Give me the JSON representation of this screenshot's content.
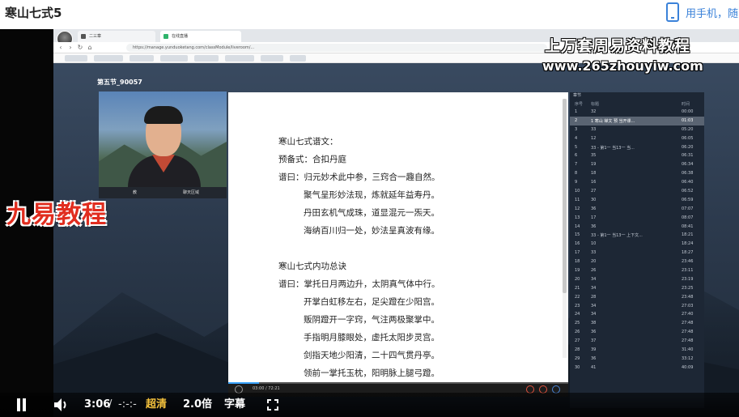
{
  "header": {
    "title": "寒山七式5",
    "phone_link": "用手机，随"
  },
  "recorded": {
    "tabs": [
      "二三章",
      "在线直播"
    ],
    "url": "https://manage.yunduoketang.com/classModule/liveroom/...",
    "lesson_title": "第五节_90057",
    "webcam_labels": [
      "教",
      "聊天区域"
    ],
    "document_lines": [
      {
        "text": "寒山七式谱文：",
        "indent": false
      },
      {
        "text": "预备式：合扣丹庭",
        "indent": false
      },
      {
        "text": "谱曰：归元妙术此中参，三窍合一趣自然。",
        "indent": false
      },
      {
        "text": "聚气呈形妙法现，炼就延年益寿丹。",
        "indent": true
      },
      {
        "text": "丹田玄机气成珠，道显混元一炁天。",
        "indent": true
      },
      {
        "text": "海纳百川归一处，妙法呈真波有缘。",
        "indent": true
      },
      {
        "text": "",
        "indent": false
      },
      {
        "text": "寒山七式内功总诀",
        "indent": false
      },
      {
        "text": "谱曰：掌托日月两边升，太阴真气体中行。",
        "indent": false
      },
      {
        "text": "开掌白虹移左右，足尖蹬在少阳宫。",
        "indent": true
      },
      {
        "text": "贩阴蹬开一字窍，气注两极聚掌中。",
        "indent": true
      },
      {
        "text": "手指明月膝眼处，虚托太阳步灵宫。",
        "indent": true
      },
      {
        "text": "剑指天地少阳清，二十四气贯丹亭。",
        "indent": true
      },
      {
        "text": "领前一掌托玉枕，阳明脉上腿弓蹬。",
        "indent": true
      }
    ],
    "player_time": "03:00 / 72:21",
    "playlist": {
      "header": "章节",
      "columns": [
        "序号",
        "标题",
        "时间"
      ],
      "rows": [
        {
          "no": "1",
          "title": "32",
          "time": "00:00"
        },
        {
          "no": "2",
          "title": "1 寒山 禅文 预 当开课...",
          "time": "01:03",
          "active": true
        },
        {
          "no": "3",
          "title": "33",
          "time": "05:20"
        },
        {
          "no": "4",
          "title": "12",
          "time": "06:05"
        },
        {
          "no": "5",
          "title": "33 - 第1一 当13一 当...",
          "time": "06:20"
        },
        {
          "no": "6",
          "title": "35",
          "time": "06:31"
        },
        {
          "no": "7",
          "title": "19",
          "time": "06:34"
        },
        {
          "no": "8",
          "title": "18",
          "time": "06:38"
        },
        {
          "no": "9",
          "title": "16",
          "time": "06:40"
        },
        {
          "no": "10",
          "title": "27",
          "time": "06:52"
        },
        {
          "no": "11",
          "title": "30",
          "time": "06:59"
        },
        {
          "no": "12",
          "title": "36",
          "time": "07:07"
        },
        {
          "no": "13",
          "title": "17",
          "time": "08:07"
        },
        {
          "no": "14",
          "title": "36",
          "time": "08:41"
        },
        {
          "no": "15",
          "title": "33 - 第1一 当13一 上下文...",
          "time": "18:21"
        },
        {
          "no": "16",
          "title": "10",
          "time": "18:24"
        },
        {
          "no": "17",
          "title": "33",
          "time": "18:27"
        },
        {
          "no": "18",
          "title": "20",
          "time": "23:46"
        },
        {
          "no": "19",
          "title": "26",
          "time": "23:11"
        },
        {
          "no": "20",
          "title": "34",
          "time": "23:19"
        },
        {
          "no": "21",
          "title": "34",
          "time": "23:25"
        },
        {
          "no": "22",
          "title": "28",
          "time": "23:48"
        },
        {
          "no": "23",
          "title": "34",
          "time": "27:03"
        },
        {
          "no": "24",
          "title": "34",
          "time": "27:40"
        },
        {
          "no": "25",
          "title": "38",
          "time": "27:48"
        },
        {
          "no": "26",
          "title": "36",
          "time": "27:48"
        },
        {
          "no": "27",
          "title": "37",
          "time": "27:48"
        },
        {
          "no": "28",
          "title": "39",
          "time": "31:40"
        },
        {
          "no": "29",
          "title": "36",
          "time": "33:12"
        },
        {
          "no": "30",
          "title": "41",
          "time": "40:09"
        }
      ]
    }
  },
  "watermarks": {
    "top_text": "上万套周易资料教程",
    "site": "www.265zhouyiw.com",
    "brand": "九易教程"
  },
  "controls": {
    "current_time": "3:06",
    "separator": "/",
    "total_time": "-:-:-",
    "quality": "超清",
    "quality_color": "#f6c33d",
    "speed": "2.0倍",
    "subtitle": "字幕",
    "icons": [
      "pause-icon",
      "volume-icon",
      "fullscreen-icon"
    ]
  }
}
